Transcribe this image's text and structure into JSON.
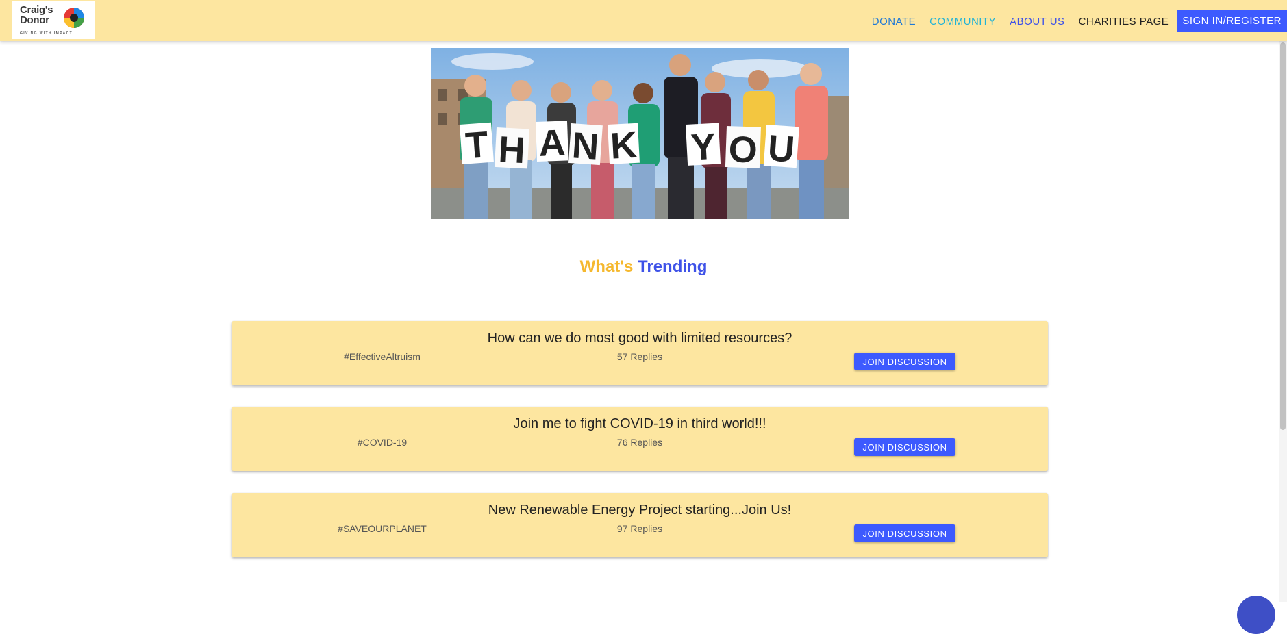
{
  "brand": {
    "line1": "Craig's",
    "line2": "Donor",
    "tagline": "GIVING WITH IMPACT"
  },
  "nav": {
    "donate": "DONATE",
    "community": "COMMUNITY",
    "about": "ABOUT US",
    "charities": "CHARITIES PAGE",
    "signin": "SIGN IN/REGISTER"
  },
  "hero": {
    "sign_letters": [
      "T",
      "H",
      "A",
      "N",
      "K",
      "Y",
      "O",
      "U"
    ]
  },
  "trending": {
    "word1": "What's",
    "word2": "Trending"
  },
  "discussions": [
    {
      "title": "How can we do most good with limited resources?",
      "tag": "#EffectiveAltruism",
      "replies": "57 Replies",
      "button": "JOIN DISCUSSION"
    },
    {
      "title": "Join me to fight COVID-19 in third world!!!",
      "tag": "#COVID-19",
      "replies": "76 Replies",
      "button": "JOIN DISCUSSION"
    },
    {
      "title": "New Renewable Energy Project starting...Join Us!",
      "tag": "#SAVEOURPLANET",
      "replies": "97 Replies",
      "button": "JOIN DISCUSSION"
    }
  ],
  "colors": {
    "nav_bg": "#fde6a0",
    "accent_blue": "#3d5afe",
    "accent_yellow": "#f5b82e",
    "card_bg": "#fde6a0"
  }
}
